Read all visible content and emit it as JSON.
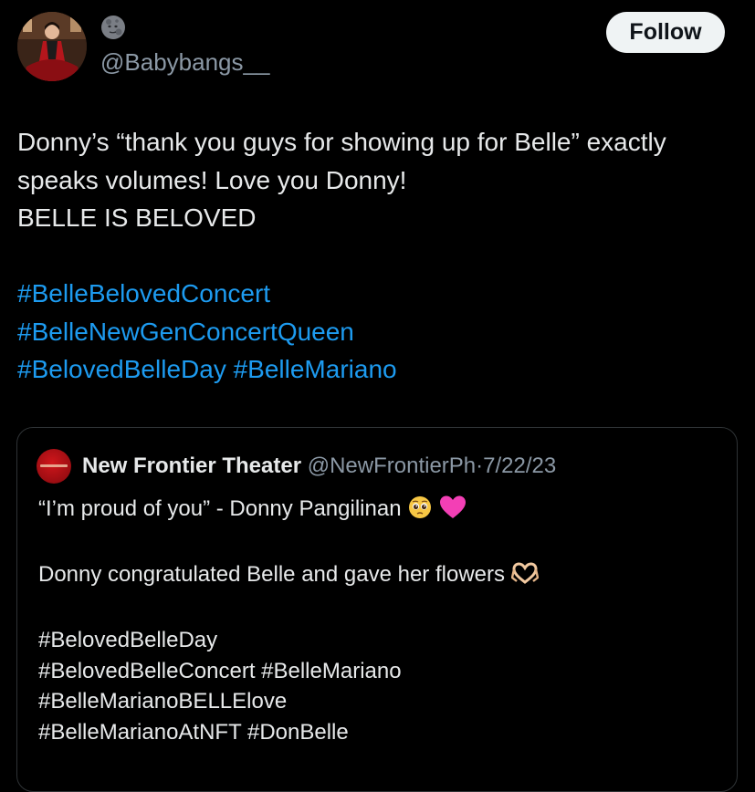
{
  "author": {
    "display_name_emoji": "moon-face-icon",
    "handle": "@Babybangs__"
  },
  "follow_button": {
    "label": "Follow"
  },
  "tweet": {
    "line1": "Donny’s “thank you guys for showing up for Belle” exactly",
    "line2": "speaks volumes! Love you Donny!",
    "line3": "BELLE IS BELOVED",
    "hashtags": {
      "h1": "#BelleBelovedConcert",
      "h2": "#BelleNewGenConcertQueen",
      "h3": "#BelovedBelleDay",
      "h4": "#BelleMariano"
    }
  },
  "quoted_tweet": {
    "name": "New Frontier Theater",
    "handle": "@NewFrontierPh",
    "separator": "·",
    "date": "7/22/23",
    "line1": "“I’m proud of you” - Donny Pangilinan",
    "line2": "Donny congratulated Belle and gave her flowers",
    "line3": "#BelovedBelleDay",
    "line4": "#BelovedBelleConcert #BelleMariano",
    "line5": "#BelleMarianoBELLElove",
    "line6": "#BelleMarianoAtNFT #DonBelle"
  },
  "colors": {
    "background": "#000000",
    "text": "#e7e9ea",
    "secondary_text": "#8b98a5",
    "link": "#1d9bf0",
    "follow_bg": "#eff3f4",
    "border": "#2f3336"
  }
}
